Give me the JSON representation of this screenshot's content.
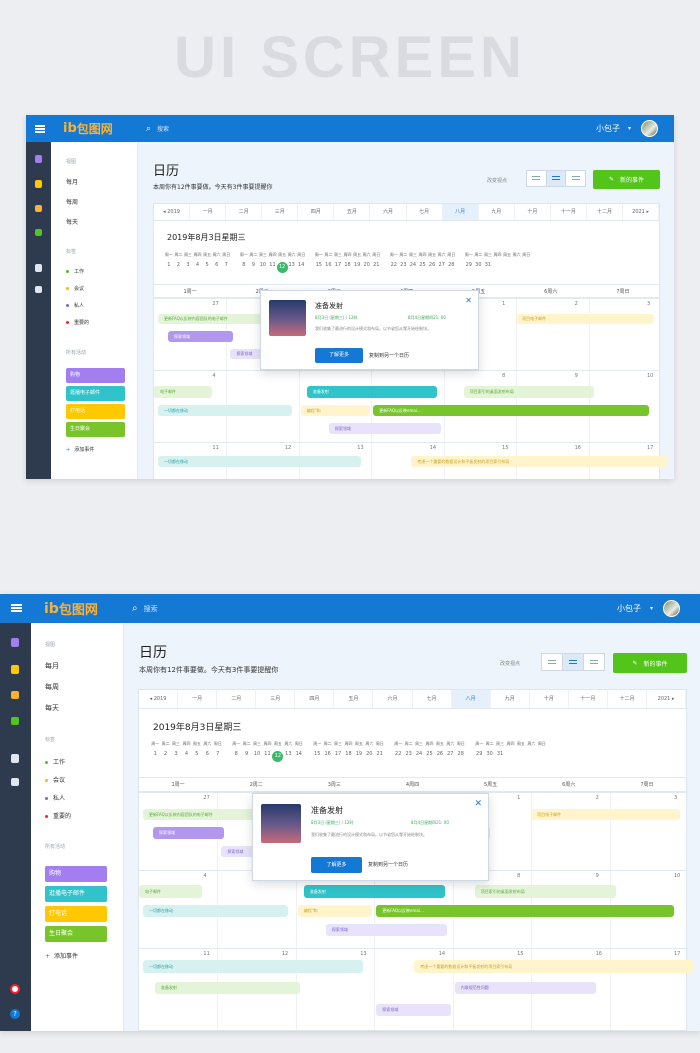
{
  "hero": {
    "title": "UI SCREEN"
  },
  "app": {
    "logo_text": "包图网",
    "search_placeholder": "搜索",
    "user_name": "小包子"
  },
  "nav": {
    "section_view": "视图",
    "views": [
      "每月",
      "每周",
      "每天"
    ],
    "section_tags": "标签",
    "tags": [
      {
        "label": "工作",
        "color": "#52c41a"
      },
      {
        "label": "会议",
        "color": "#ffb02e"
      },
      {
        "label": "私人",
        "color": "#7a66c9"
      },
      {
        "label": "重要的",
        "color": "#f5222d"
      }
    ],
    "section_events": "所有活动",
    "event_tags": [
      {
        "label": "购物",
        "color": "#a27ef0"
      },
      {
        "label": "逛播电子邮件",
        "color": "#30c3c9"
      },
      {
        "label": "打电话",
        "color": "#ffc800"
      },
      {
        "label": "生日聚会",
        "color": "#78c52b"
      }
    ],
    "add_event": "添加事件"
  },
  "page": {
    "title": "日历",
    "subtitle": "本周你有12件事要做。今天有3件事要提醒你",
    "change_view": "改变视点",
    "new_event": "新的事件"
  },
  "months": [
    "◂ 2019",
    "一月",
    "二月",
    "三月",
    "四月",
    "五月",
    "六月",
    "七月",
    "八月",
    "九月",
    "十月",
    "十一月",
    "十二月",
    "2021 ▸"
  ],
  "active_month_index": 8,
  "date_title": "2019年8月3日星期三",
  "week_labels": [
    "周一",
    "周二",
    "周三",
    "周四",
    "周五",
    "周六",
    "周日"
  ],
  "week_strips": [
    [
      "1",
      "2",
      "3",
      "4",
      "5",
      "6",
      "7"
    ],
    [
      "8",
      "9",
      "10",
      "11",
      "12",
      "13",
      "14"
    ],
    [
      "15",
      "16",
      "17",
      "18",
      "19",
      "20",
      "21"
    ],
    [
      "22",
      "23",
      "24",
      "25",
      "26",
      "27",
      "28"
    ],
    [
      "29",
      "30",
      "31",
      "",
      "",
      "",
      ""
    ]
  ],
  "today": "12",
  "day_headers": [
    "1周一",
    "2周二",
    "3周三",
    "4周四",
    "5周五",
    "6周六",
    "7周日"
  ],
  "popup": {
    "title": "准备发射",
    "start": "8月3日 (星期三) / 12时",
    "end": "8月4日星期四21: 00",
    "desc": "我们收集了最流行的设计模式和布局。以节省您从零开始绘制块。",
    "primary": "了解更多",
    "secondary": "复制到另一个日历"
  },
  "events": {
    "e1": "更新FAQ以反映内容团队的电子邮件",
    "e2": "探索领域",
    "e3": "探索领域",
    "e4": "探索领域",
    "e5": "项目电子邮件",
    "e6": "电子邮件",
    "e7": "准备发射",
    "e8": "项目索引的桌面发射布局",
    "e9": "一切都在移动",
    "e10": "编程\"和",
    "e11": "更新FAQ以反映emai…",
    "e12": "探索领域",
    "e13": "一切都在移动",
    "e14": "考虑一个重要的数据设计和平板发射的项目索引布局",
    "e15": "准备发射",
    "e16": "内联规范性问题",
    "e17": "探索领域"
  },
  "day_numbers": {
    "r1": [
      "27",
      "1",
      "2",
      "3"
    ],
    "r2": [
      "4",
      "8",
      "9",
      "10"
    ],
    "r3": [
      "11",
      "12",
      "13",
      "14",
      "15",
      "16",
      "17"
    ]
  }
}
